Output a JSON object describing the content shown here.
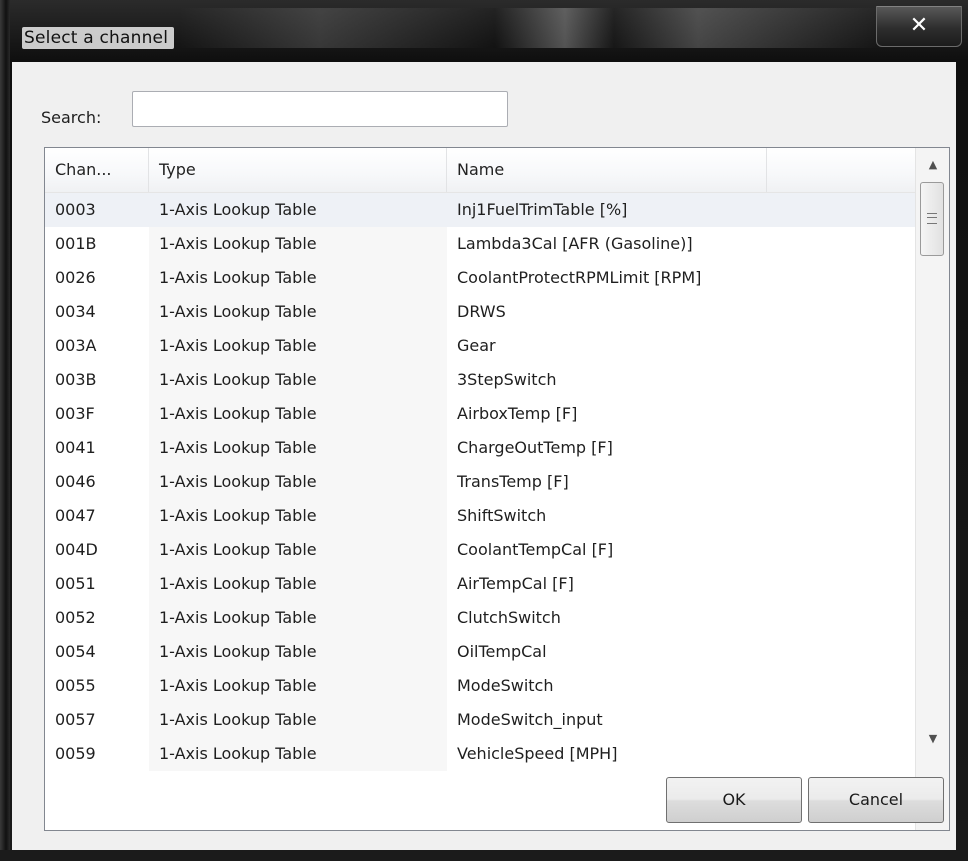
{
  "window": {
    "title": "Select a channel",
    "close_glyph": "✕"
  },
  "search": {
    "label": "Search:",
    "value": "",
    "placeholder": ""
  },
  "list": {
    "columns": [
      "Chan...",
      "Type",
      "Name"
    ],
    "rows": [
      {
        "channel": "0003",
        "type": "1-Axis Lookup Table",
        "name": "Inj1FuelTrimTable [%]"
      },
      {
        "channel": "001B",
        "type": "1-Axis Lookup Table",
        "name": "Lambda3Cal [AFR (Gasoline)]"
      },
      {
        "channel": "0026",
        "type": "1-Axis Lookup Table",
        "name": "CoolantProtectRPMLimit [RPM]"
      },
      {
        "channel": "0034",
        "type": "1-Axis Lookup Table",
        "name": "DRWS"
      },
      {
        "channel": "003A",
        "type": "1-Axis Lookup Table",
        "name": "Gear"
      },
      {
        "channel": "003B",
        "type": "1-Axis Lookup Table",
        "name": "3StepSwitch"
      },
      {
        "channel": "003F",
        "type": "1-Axis Lookup Table",
        "name": "AirboxTemp [F]"
      },
      {
        "channel": "0041",
        "type": "1-Axis Lookup Table",
        "name": "ChargeOutTemp [F]"
      },
      {
        "channel": "0046",
        "type": "1-Axis Lookup Table",
        "name": "TransTemp [F]"
      },
      {
        "channel": "0047",
        "type": "1-Axis Lookup Table",
        "name": "ShiftSwitch"
      },
      {
        "channel": "004D",
        "type": "1-Axis Lookup Table",
        "name": "CoolantTempCal [F]"
      },
      {
        "channel": "0051",
        "type": "1-Axis Lookup Table",
        "name": "AirTempCal [F]"
      },
      {
        "channel": "0052",
        "type": "1-Axis Lookup Table",
        "name": "ClutchSwitch"
      },
      {
        "channel": "0054",
        "type": "1-Axis Lookup Table",
        "name": "OilTempCal"
      },
      {
        "channel": "0055",
        "type": "1-Axis Lookup Table",
        "name": "ModeSwitch"
      },
      {
        "channel": "0057",
        "type": "1-Axis Lookup Table",
        "name": "ModeSwitch_input"
      },
      {
        "channel": "0059",
        "type": "1-Axis Lookup Table",
        "name": "VehicleSpeed [MPH]"
      }
    ],
    "selected_index": 0
  },
  "scrollbar": {
    "up_glyph": "▲",
    "down_glyph": "▼"
  },
  "buttons": {
    "ok_label": "OK",
    "cancel_label": "Cancel"
  }
}
